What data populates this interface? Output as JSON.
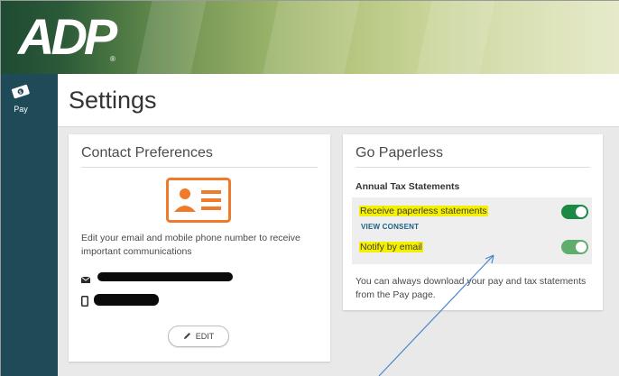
{
  "brand": {
    "logo_text": "ADP"
  },
  "nav": {
    "items": [
      {
        "label": "Pay",
        "icon": "money-icon"
      }
    ]
  },
  "page": {
    "title": "Settings"
  },
  "contact_card": {
    "title": "Contact Preferences",
    "icon": "contact-card-icon",
    "description": "Edit your email and mobile phone number to receive important communications",
    "email_icon": "envelope-icon",
    "phone_icon": "mobile-phone-icon",
    "edit_label": "EDIT"
  },
  "paperless_card": {
    "title": "Go Paperless",
    "section_label": "Annual Tax Statements",
    "options": [
      {
        "label": "Receive paperless statements",
        "enabled": true
      },
      {
        "label": "Notify by email",
        "enabled": true
      }
    ],
    "view_consent": "VIEW CONSENT",
    "note": "You can always download your pay and tax statements from the Pay page."
  },
  "colors": {
    "nav_bg": "#1e4b57",
    "accent_orange": "#f07a2a",
    "toggle_on": "#1b8a45",
    "highlight": "#f4f000",
    "link": "#1d5f86"
  }
}
